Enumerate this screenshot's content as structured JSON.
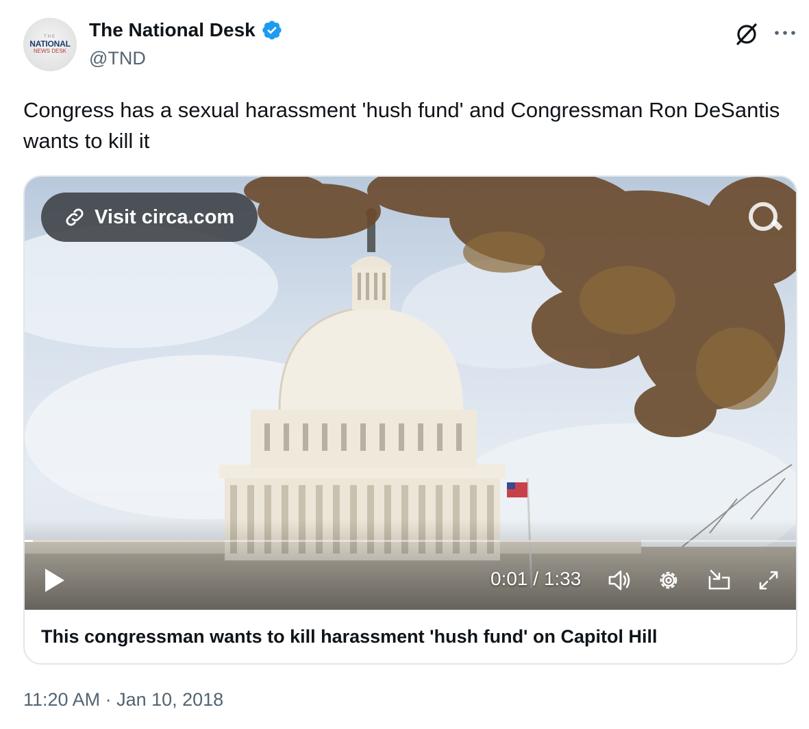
{
  "account": {
    "avatar_text_top": "THE",
    "avatar_text_main": "NATIONAL",
    "avatar_text_sub": "NEWS DESK",
    "display_name": "The National Desk",
    "handle": "@TND",
    "verified": true
  },
  "tweet": {
    "text": "Congress has a sexual harassment 'hush fund' and Congressman Ron DeSantis wants to kill it",
    "timestamp": "11:20 AM · Jan 10, 2018"
  },
  "media": {
    "visit_link_label": "Visit circa.com",
    "time_display": "0:01 / 1:33",
    "progress_fraction": 0.011,
    "caption": "This congressman wants to kill harassment 'hush fund' on Capitol Hill"
  },
  "icons": {
    "verified": "verified-badge-icon",
    "grok": "grok-icon",
    "more": "more-horizontal-icon",
    "link": "link-icon",
    "play": "play-icon",
    "volume": "volume-icon",
    "settings": "settings-gear-icon",
    "pip": "picture-in-picture-icon",
    "fullscreen": "fullscreen-icon"
  },
  "colors": {
    "verified_blue": "#1d9bf0",
    "secondary_text": "#536471",
    "primary_text": "#0f1419",
    "border": "#e1e6ea"
  }
}
